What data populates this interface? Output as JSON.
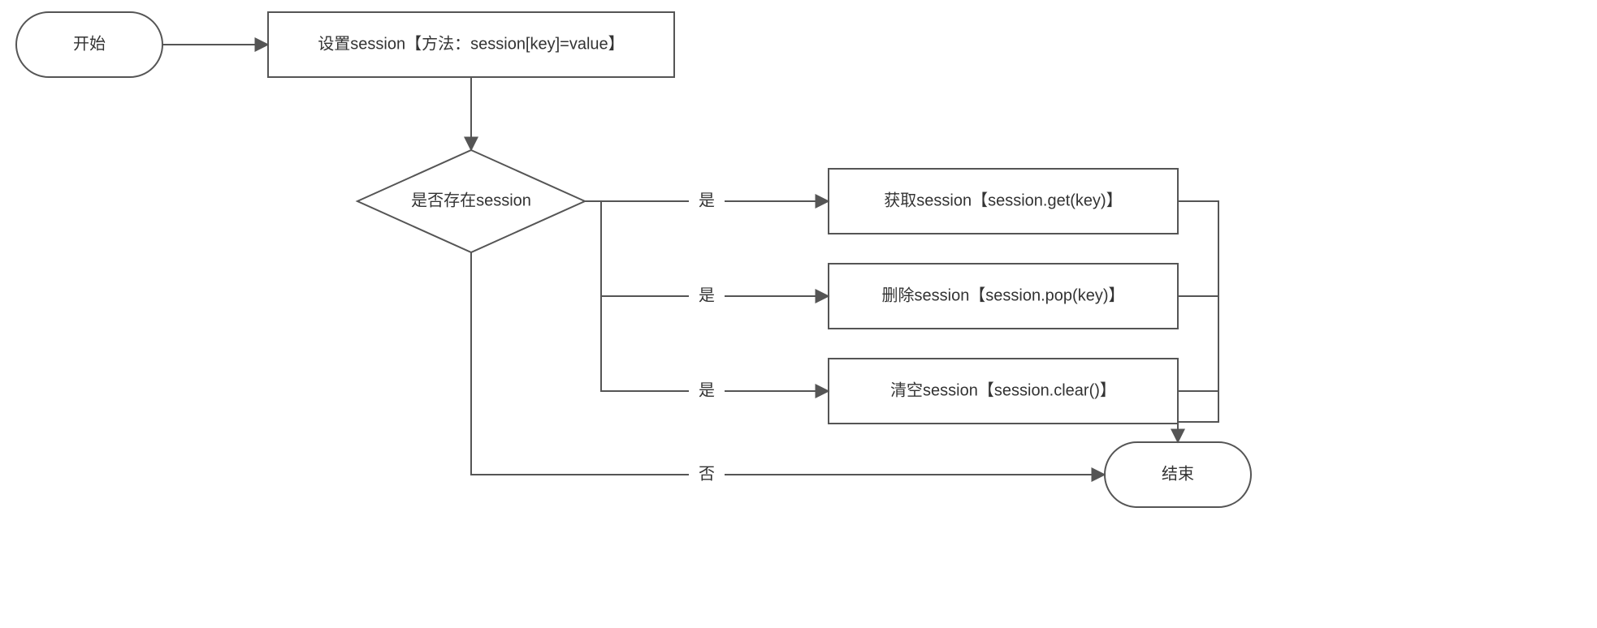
{
  "nodes": {
    "start": "开始",
    "setSession": "设置session【方法：session[key]=value】",
    "decision": "是否存在session",
    "getSession": "获取session【session.get(key)】",
    "delSession": "删除session【session.pop(key)】",
    "clearSession": "清空session【session.clear()】",
    "end": "结束"
  },
  "edges": {
    "yes": "是",
    "no": "否"
  }
}
